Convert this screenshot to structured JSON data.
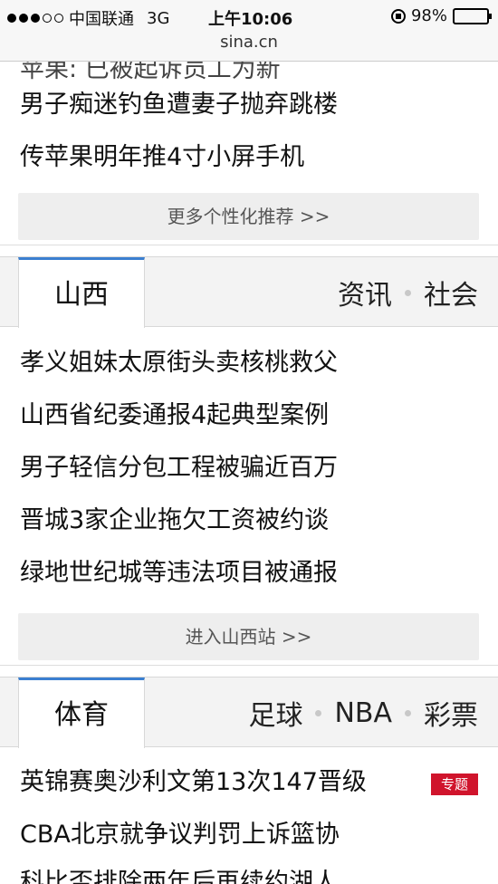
{
  "status": {
    "carrier": "中国联通",
    "network": "3G",
    "time": "上午10:06",
    "battery_text": "98%",
    "battery_level": 0.98
  },
  "url": "sina.cn",
  "top_section": {
    "clipped_headline": "苹果: 已被起诉员工为新",
    "headlines": [
      "男子痴迷钓鱼遭妻子抛弃跳楼",
      "传苹果明年推4寸小屏手机"
    ],
    "more_button": "更多个性化推荐 >>"
  },
  "shanxi": {
    "tab": "山西",
    "links": [
      "资讯",
      "社会"
    ],
    "headlines": [
      "孝义姐妹太原街头卖核桃救父",
      "山西省纪委通报4起典型案例",
      "男子轻信分包工程被骗近百万",
      "晋城3家企业拖欠工资被约谈",
      "绿地世纪城等违法项目被通报"
    ],
    "enter_button": "进入山西站 >>"
  },
  "sports": {
    "tab": "体育",
    "links": [
      "足球",
      "NBA",
      "彩票"
    ],
    "headlines": [
      "英锦赛奥沙利文第13次147晋级",
      "CBA北京就争议判罚上诉篮协",
      "科比否排除两年后再续约湖人"
    ],
    "badge": "专题"
  }
}
